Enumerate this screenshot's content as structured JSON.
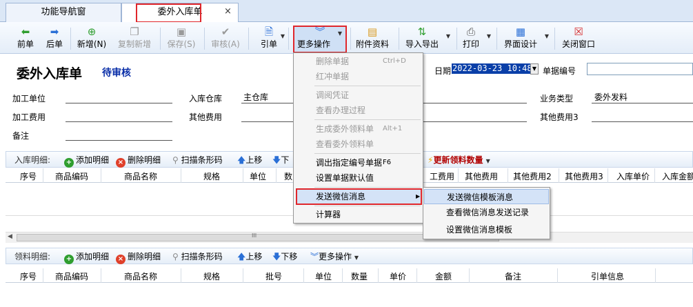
{
  "tabs": [
    {
      "label": "功能导航窗"
    },
    {
      "label": "委外入库单"
    }
  ],
  "close_glyph": "×",
  "toolbar": {
    "prev": "前单",
    "next": "后单",
    "add": "新增(N)",
    "copy_add": "复制新增",
    "save": "保存(S)",
    "audit": "审核(A)",
    "ref": "引单",
    "more": "更多操作",
    "attach": "附件资料",
    "import_export": "导入导出",
    "print": "打印",
    "ui_design": "界面设计",
    "close": "关闭窗口"
  },
  "doc": {
    "title": "委外入库单",
    "status": "待审核",
    "date_label": "日期",
    "date_value": "2022-03-23 10:48",
    "docno_label": "单据编号",
    "proc_unit_label": "加工单位",
    "warehouse_label": "入库仓库",
    "warehouse_value": "主仓库",
    "biz_type_label": "业务类型",
    "biz_type_value": "委外发料",
    "proc_fee_label": "加工费用",
    "other_fee_label": "其他费用",
    "other_fee3_label": "其他费用3",
    "remark_label": "备注"
  },
  "in_bar": {
    "title": "入库明细:",
    "add": "添加明细",
    "del": "删除明细",
    "scan": "扫描条形码",
    "up": "上移",
    "down": "下",
    "update_qty": "更新领料数量"
  },
  "in_grid": {
    "columns": [
      "序号",
      "商品编码",
      "商品名称",
      "规格",
      "单位",
      "数",
      "工费用",
      "其他费用",
      "其他费用2",
      "其他费用3",
      "入库单价",
      "入库金额"
    ]
  },
  "scroll_glyph": "III",
  "out_bar": {
    "title": "领料明细:",
    "add": "添加明细",
    "del": "删除明细",
    "scan": "扫描条形码",
    "up": "上移",
    "down": "下移",
    "more": "更多操作"
  },
  "out_grid": {
    "columns": [
      "序号",
      "商品编码",
      "商品名称",
      "规格",
      "批号",
      "单位",
      "数量",
      "单价",
      "金额",
      "备注",
      "引单信息"
    ]
  },
  "menu": {
    "items": [
      {
        "label": "删除单据",
        "shortcut": "Ctrl+D"
      },
      {
        "label": "红冲单据",
        "shortcut": ""
      },
      {
        "label": "调阅凭证",
        "shortcut": ""
      },
      {
        "label": "查看办理过程",
        "shortcut": ""
      },
      {
        "label": "生成委外领料单",
        "shortcut": "Alt+1"
      },
      {
        "label": "查看委外领料单",
        "shortcut": ""
      },
      {
        "label": "调出指定编号单据",
        "shortcut": "F6"
      },
      {
        "label": "设置单据默认值",
        "shortcut": ""
      },
      {
        "label": "发送微信消息",
        "shortcut": ""
      },
      {
        "label": "计算器",
        "shortcut": ""
      }
    ]
  },
  "submenu": {
    "items": [
      {
        "label": "发送微信模板消息"
      },
      {
        "label": "查看微信消息发送记录"
      },
      {
        "label": "设置微信消息模板"
      }
    ]
  }
}
